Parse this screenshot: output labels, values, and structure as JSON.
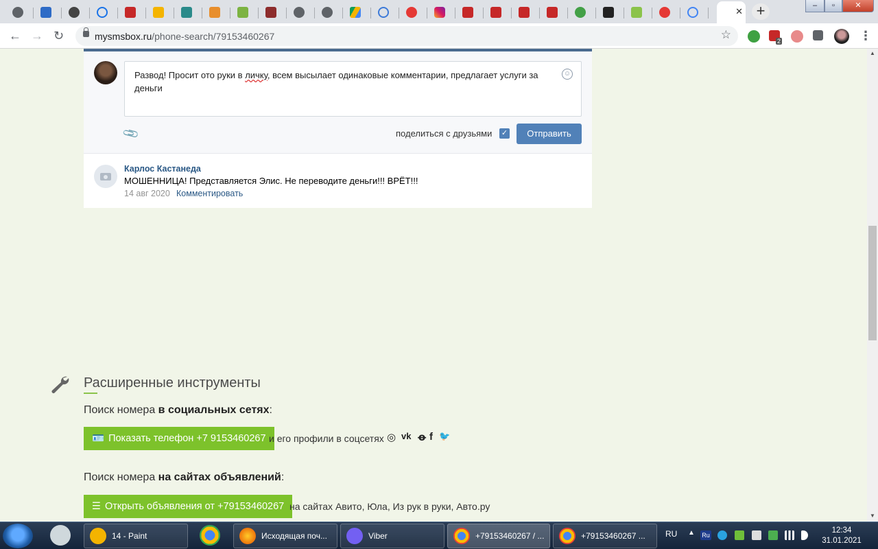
{
  "browser": {
    "url_host": "mysmsbox.ru",
    "url_path": "/phone-search/79153460267",
    "tab_x": "✕",
    "new_tab": "+",
    "back": "←",
    "forward": "→",
    "reload": "↻",
    "star": "☆",
    "menu": "⋮",
    "window_min": "–",
    "window_max": "▫",
    "window_close": "✕",
    "abp_badge": "2"
  },
  "composer": {
    "text_before": "Развод! Просит ото руки в ",
    "text_spell": "личку",
    "text_after": ", всем высылает одинаковые комментарии, предлагает услуги за деньги",
    "smile_icon": "☺",
    "share_label": "поделиться с друзьями",
    "share_checked": "✓",
    "send_label": "Отправить"
  },
  "comment": {
    "author": "Карлос Кастанеда",
    "text": "МОШЕННИЦА! Представляется Элис. Не переводите деньги!!! ВРЁТ!!!",
    "date": "14 авг 2020",
    "reply": "Комментировать"
  },
  "tools": {
    "title": "Расширенные инструменты",
    "social_prefix": "Поиск номера ",
    "social_bold": "в социальных сетях",
    "social_suffix": ":",
    "show_phone_button": "Показать телефон +7 9153460267",
    "show_phone_after": "и его профили в соцсетях",
    "social_icons": [
      "instagram-icon",
      "vk-icon",
      "ok-icon",
      "facebook-icon",
      "twitter-icon"
    ],
    "social_glyphs": [
      "◎",
      "vk",
      "ꝋ",
      "f",
      "🐦"
    ],
    "ads_prefix": "Поиск номера ",
    "ads_bold": "на сайтах объявлений",
    "ads_suffix": ":",
    "open_ads_button": "Открыть объявления от +79153460267",
    "open_ads_after": "на сайтах Авито, Юла, Из рук в руки, Авто.ру"
  },
  "taskbar": {
    "items": [
      {
        "label": "14 - Paint"
      },
      {
        "label": "Исходящая поч..."
      },
      {
        "label": "Viber"
      },
      {
        "label": "+79153460267 / ..."
      },
      {
        "label": "+79153460267 ..."
      }
    ],
    "lang": "RU",
    "lang_tray": "Ru",
    "time": "12:34",
    "date": "31.01.2021"
  },
  "colors": {
    "page_bg": "#f1f5e8",
    "vk_blue": "#5181b8",
    "link_blue": "#2a5885",
    "green_button": "#7dc22b"
  }
}
